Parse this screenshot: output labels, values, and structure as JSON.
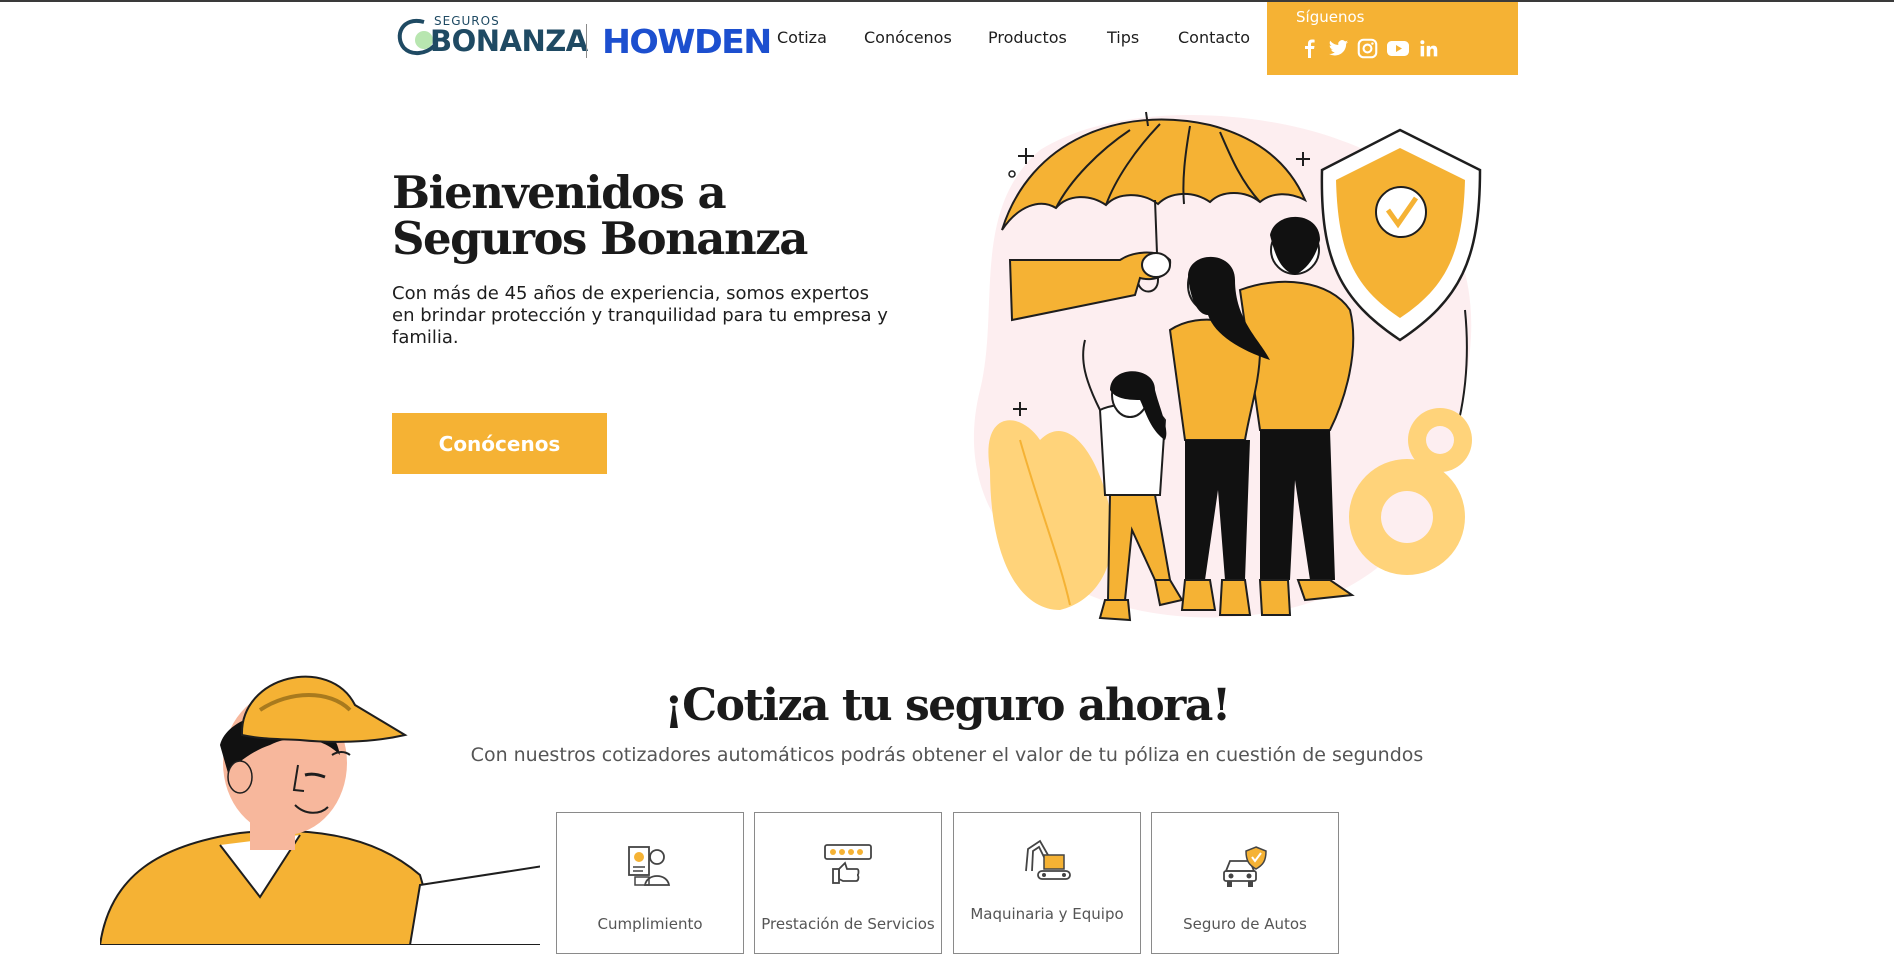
{
  "header": {
    "logo": {
      "small": "SEGUROS",
      "big": "BONANZA",
      "partner": "HOWDEN"
    },
    "nav": [
      "Cotiza",
      "Conócenos",
      "Productos",
      "Tips",
      "Contacto"
    ],
    "social": {
      "title": "Síguenos",
      "icons": [
        "facebook-icon",
        "twitter-icon",
        "instagram-icon",
        "youtube-icon",
        "linkedin-icon"
      ]
    }
  },
  "hero": {
    "title": "Bienvenidos a Seguros Bonanza",
    "text": "Con más de 45 años de experiencia, somos expertos en brindar protección y tranquilidad para tu empresa y familia.",
    "button": "Conócenos"
  },
  "quote": {
    "title": "¡Cotiza tu seguro ahora!",
    "subtitle": "Con nuestros cotizadores automáticos podrás obtener el valor de tu póliza en cuestión de segundos",
    "cards": [
      {
        "label": "Cumplimiento",
        "icon": "contract-person-icon"
      },
      {
        "label": "Prestación de Servicios",
        "icon": "thumbs-up-rating-icon"
      },
      {
        "label": "Maquinaria y Equipo",
        "icon": "excavator-icon"
      },
      {
        "label": "Seguro de Autos",
        "icon": "car-shield-icon"
      }
    ]
  },
  "colors": {
    "accent": "#f5b234",
    "brand_dark": "#1f4a63",
    "partner_blue": "#1c4fcf",
    "blush": "#fdeef0"
  }
}
